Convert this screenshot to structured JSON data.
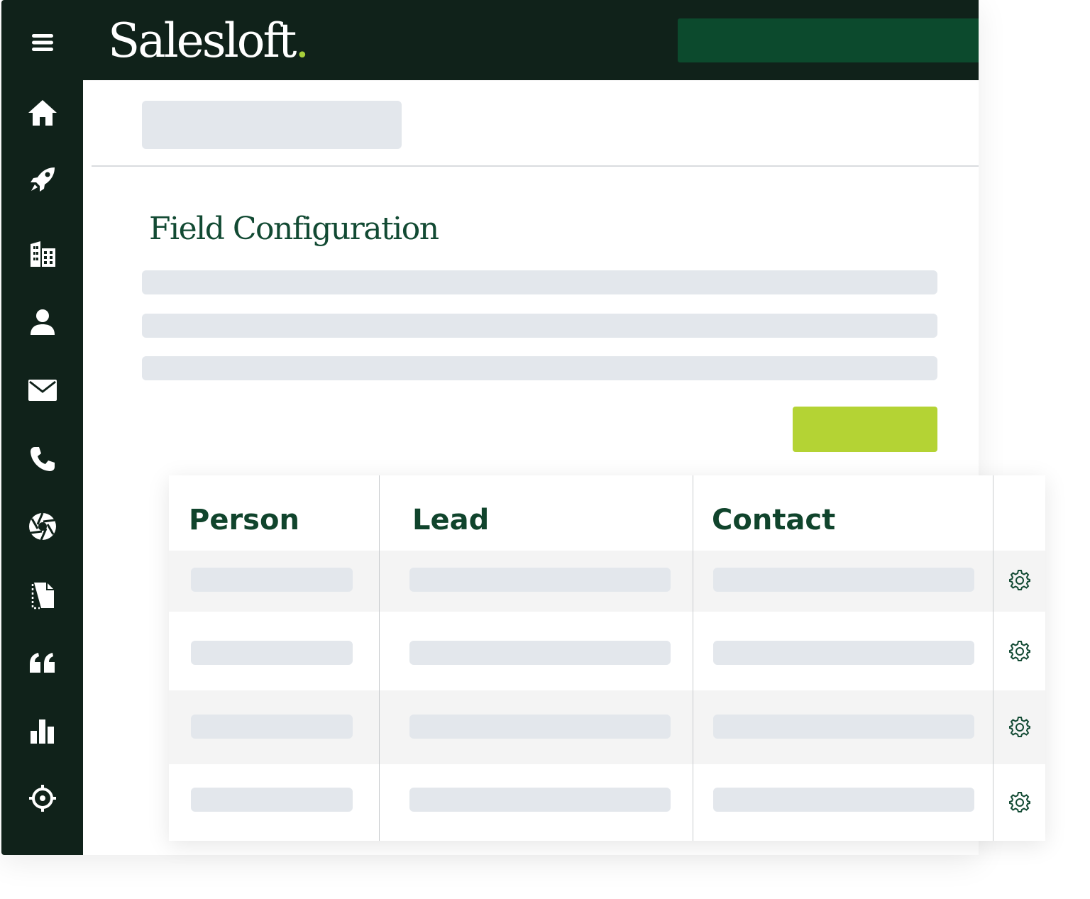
{
  "brand": {
    "name": "Salesloft",
    "dot": ".",
    "accent": "#a7cf3a"
  },
  "colors": {
    "sidebar": "#10221a",
    "topbar_block": "#0c4a2d",
    "title": "#124a33",
    "cta": "#b4d334",
    "placeholder": "#e3e7ec"
  },
  "sidebar": {
    "items": [
      {
        "icon": "menu-icon"
      },
      {
        "icon": "home-icon"
      },
      {
        "icon": "rocket-icon"
      },
      {
        "icon": "building-icon"
      },
      {
        "icon": "person-icon"
      },
      {
        "icon": "mail-icon"
      },
      {
        "icon": "phone-icon"
      },
      {
        "icon": "aperture-icon"
      },
      {
        "icon": "document-icon"
      },
      {
        "icon": "quote-icon"
      },
      {
        "icon": "bar-chart-icon"
      },
      {
        "icon": "crosshair-icon"
      }
    ]
  },
  "main": {
    "title": "Field Configuration"
  },
  "table": {
    "headers": [
      "Person",
      "Lead",
      "Contact"
    ],
    "row_action_icon": "gear-icon",
    "row_count": 4
  }
}
